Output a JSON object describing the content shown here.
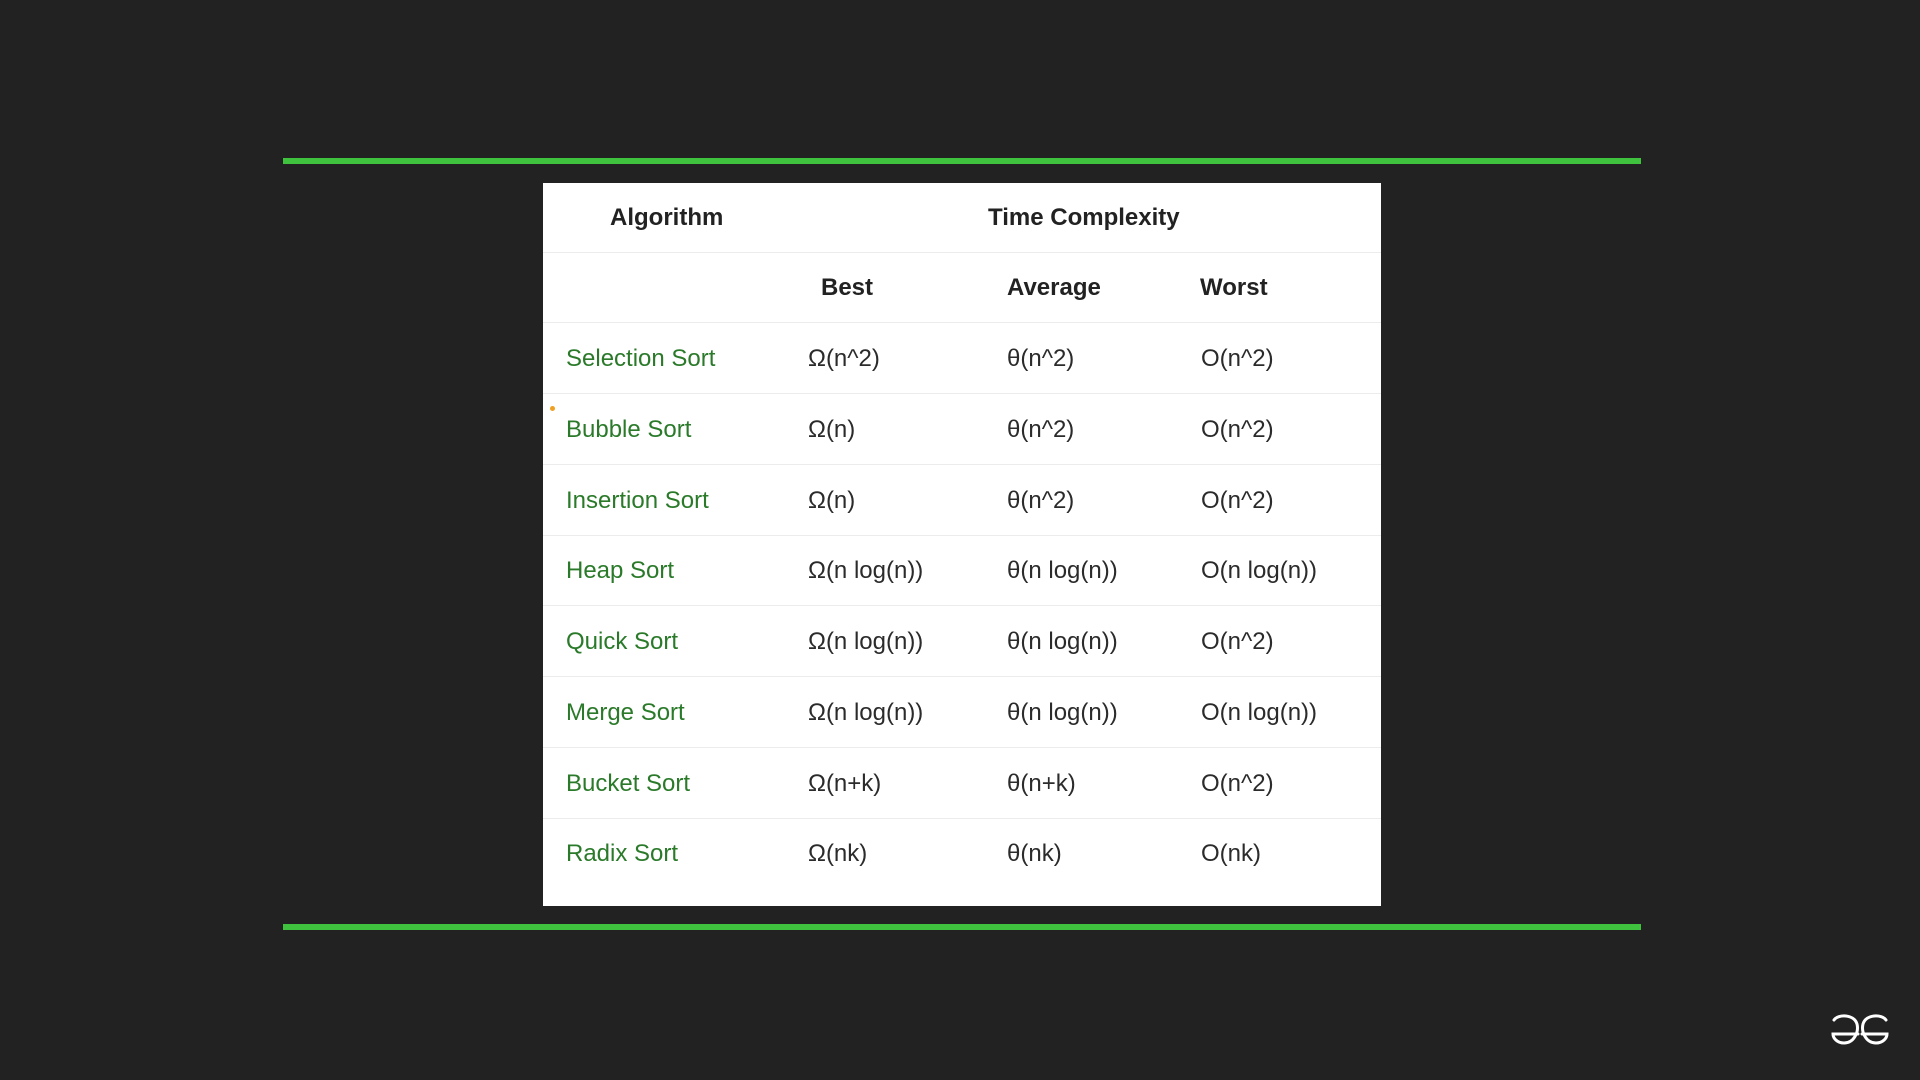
{
  "table": {
    "header": {
      "algorithm": "Algorithm",
      "time_complexity": "Time Complexity"
    },
    "subheader": {
      "best": "Best",
      "average": "Average",
      "worst": "Worst"
    },
    "rows": [
      {
        "algorithm": "Selection Sort",
        "best": "Ω(n^2)",
        "average": "θ(n^2)",
        "worst": "O(n^2)"
      },
      {
        "algorithm": "Bubble Sort",
        "best": "Ω(n)",
        "average": "θ(n^2)",
        "worst": "O(n^2)"
      },
      {
        "algorithm": "Insertion Sort",
        "best": "Ω(n)",
        "average": "θ(n^2)",
        "worst": "O(n^2)"
      },
      {
        "algorithm": "Heap Sort",
        "best": "Ω(n log(n))",
        "average": "θ(n log(n))",
        "worst": "O(n log(n))"
      },
      {
        "algorithm": "Quick Sort",
        "best": "Ω(n log(n))",
        "average": "θ(n log(n))",
        "worst": "O(n^2)"
      },
      {
        "algorithm": "Merge Sort",
        "best": "Ω(n log(n))",
        "average": "θ(n log(n))",
        "worst": "O(n log(n))"
      },
      {
        "algorithm": "Bucket Sort",
        "best": "Ω(n+k)",
        "average": "θ(n+k)",
        "worst": "O(n^2)"
      },
      {
        "algorithm": "Radix Sort",
        "best": "Ω(nk)",
        "average": "θ(nk)",
        "worst": "O(nk)"
      }
    ]
  },
  "colors": {
    "background": "#222222",
    "accent_rule": "#3fc33f",
    "algorithm_text": "#2a7a2a",
    "body_text": "#2b2b2b"
  },
  "icons": {
    "logo": "gfg-logo-icon"
  }
}
